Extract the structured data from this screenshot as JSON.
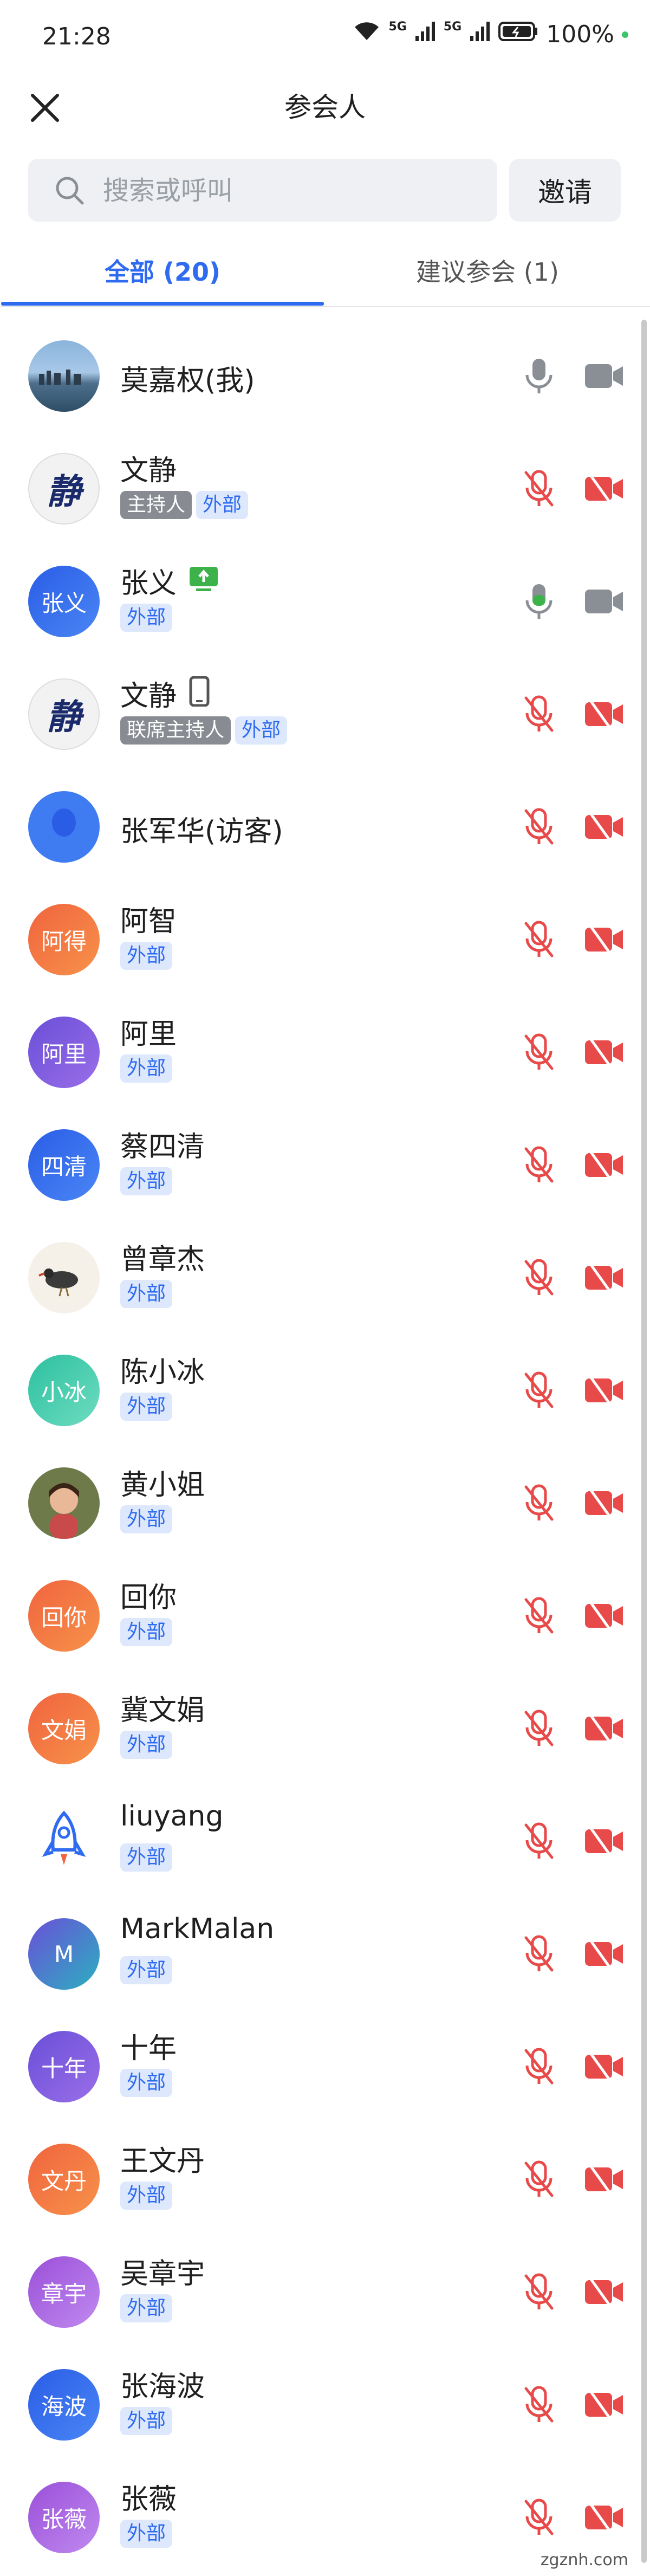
{
  "status": {
    "time": "21:28",
    "battery": "100%",
    "network1": "5G",
    "network2": "5G"
  },
  "header": {
    "title": "参会人"
  },
  "search": {
    "placeholder": "搜索或呼叫",
    "value": ""
  },
  "invite_label": "邀请",
  "tabs": [
    {
      "label": "全部 (20)"
    },
    {
      "label": "建议参会 (1)"
    }
  ],
  "participants": [
    {
      "name": "莫嘉权(我)",
      "avatar_text": "",
      "avatar_type": "photo-city",
      "tags": [],
      "mic": "on-gray",
      "cam": "on-gray"
    },
    {
      "name": "文静",
      "avatar_text": "静",
      "avatar_type": "calligraphy",
      "tags": [
        "主持人",
        "外部"
      ],
      "mic": "muted",
      "cam": "off"
    },
    {
      "name": "张义",
      "avatar_text": "张义",
      "avatar_type": "color",
      "color_a": "#2a5de6",
      "color_b": "#4a86f5",
      "tags": [
        "外部"
      ],
      "badge": "share-screen",
      "mic": "on-green",
      "cam": "on-gray"
    },
    {
      "name": "文静",
      "avatar_text": "静",
      "avatar_type": "calligraphy",
      "tags": [
        "联席主持人",
        "外部"
      ],
      "badge": "phone",
      "mic": "muted",
      "cam": "off"
    },
    {
      "name": "张军华(访客)",
      "avatar_text": "",
      "avatar_type": "guest",
      "tags": [],
      "mic": "muted",
      "cam": "off"
    },
    {
      "name": "阿智",
      "avatar_text": "阿得",
      "avatar_type": "color",
      "color_a": "#f0643e",
      "color_b": "#f7924a",
      "tags": [
        "外部"
      ],
      "mic": "muted",
      "cam": "off"
    },
    {
      "name": "阿里",
      "avatar_text": "阿里",
      "avatar_type": "color",
      "color_a": "#6a4fd8",
      "color_b": "#9a6ee8",
      "tags": [
        "外部"
      ],
      "mic": "muted",
      "cam": "off"
    },
    {
      "name": "蔡四清",
      "avatar_text": "四清",
      "avatar_type": "color",
      "color_a": "#2a5de6",
      "color_b": "#4a86f5",
      "tags": [
        "外部"
      ],
      "mic": "muted",
      "cam": "off"
    },
    {
      "name": "曾章杰",
      "avatar_text": "",
      "avatar_type": "photo-bird",
      "tags": [
        "外部"
      ],
      "mic": "muted",
      "cam": "off"
    },
    {
      "name": "陈小冰",
      "avatar_text": "小冰",
      "avatar_type": "color",
      "color_a": "#2cc0a0",
      "color_b": "#6fdcc0",
      "tags": [
        "外部"
      ],
      "mic": "muted",
      "cam": "off"
    },
    {
      "name": "黄小姐",
      "avatar_text": "",
      "avatar_type": "photo-girl",
      "tags": [
        "外部"
      ],
      "mic": "muted",
      "cam": "off"
    },
    {
      "name": "回你",
      "avatar_text": "回你",
      "avatar_type": "color",
      "color_a": "#f0643e",
      "color_b": "#f7924a",
      "tags": [
        "外部"
      ],
      "mic": "muted",
      "cam": "off"
    },
    {
      "name": "冀文娟",
      "avatar_text": "文娟",
      "avatar_type": "color",
      "color_a": "#f0643e",
      "color_b": "#f7924a",
      "tags": [
        "外部"
      ],
      "mic": "muted",
      "cam": "off"
    },
    {
      "name": "liuyang",
      "avatar_text": "",
      "avatar_type": "rocket",
      "tags": [
        "外部"
      ],
      "mic": "muted",
      "cam": "off"
    },
    {
      "name": "MarkMalan",
      "avatar_text": "M",
      "avatar_type": "color",
      "color_a": "#6a4fd8",
      "color_b": "#2cb0c0",
      "tags": [
        "外部"
      ],
      "mic": "muted",
      "cam": "off"
    },
    {
      "name": "十年",
      "avatar_text": "十年",
      "avatar_type": "color",
      "color_a": "#6a4fd8",
      "color_b": "#9a6ee8",
      "tags": [
        "外部"
      ],
      "mic": "muted",
      "cam": "off"
    },
    {
      "name": "王文丹",
      "avatar_text": "文丹",
      "avatar_type": "color",
      "color_a": "#f0643e",
      "color_b": "#f7924a",
      "tags": [
        "外部"
      ],
      "mic": "muted",
      "cam": "off"
    },
    {
      "name": "吴章宇",
      "avatar_text": "章宇",
      "avatar_type": "color",
      "color_a": "#9a4fd8",
      "color_b": "#c08af0",
      "tags": [
        "外部"
      ],
      "mic": "muted",
      "cam": "off"
    },
    {
      "name": "张海波",
      "avatar_text": "海波",
      "avatar_type": "color",
      "color_a": "#2a5de6",
      "color_b": "#4a86f5",
      "tags": [
        "外部"
      ],
      "mic": "muted",
      "cam": "off"
    },
    {
      "name": "张薇",
      "avatar_text": "张薇",
      "avatar_type": "color",
      "color_a": "#9a4fd8",
      "color_b": "#c08af0",
      "tags": [
        "外部"
      ],
      "mic": "muted",
      "cam": "off"
    }
  ],
  "watermark": "zgznh.com",
  "colors": {
    "accent": "#2f6bf0",
    "muted_red": "#e84a4a",
    "mic_green": "#3db24a",
    "icon_gray": "#8a8f96"
  }
}
